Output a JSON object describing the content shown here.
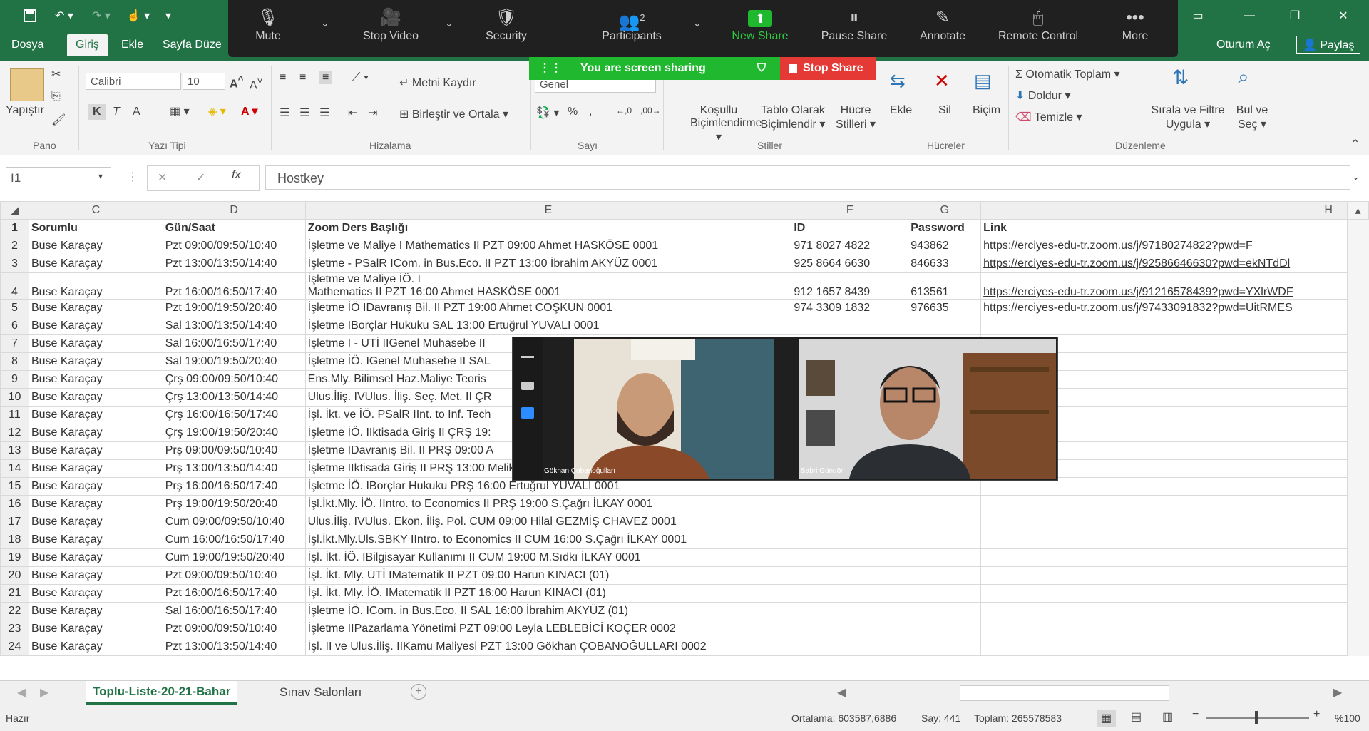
{
  "colors": {
    "excel_green": "#217346",
    "zoom_dark": "#202020",
    "share_green": "#1fb82e",
    "share_red": "#e53935",
    "link_blue": "#1a5fd6"
  },
  "excel": {
    "tabs": [
      "Dosya",
      "Giriş",
      "Ekle",
      "Sayfa Düze"
    ],
    "active_tab": "Giriş",
    "account": "Oturum Aç",
    "share": "Paylaş",
    "ribbon": {
      "paste": "Yapıştır",
      "font_name": "Calibri",
      "font_size": "10",
      "bold": "K",
      "italic": "T",
      "underline": "A",
      "wrap_text": "Metni Kaydır",
      "merge_center": "Birleştir ve Ortala",
      "number_format": "Genel",
      "conditional_1": "Koşullu",
      "conditional_2": "Biçimlendirme",
      "table_1": "Tablo Olarak",
      "table_2": "Biçimlendir",
      "cell_1": "Hücre",
      "cell_2": "Stilleri",
      "insert": "Ekle",
      "delete": "Sil",
      "format": "Biçim",
      "autosum": "Otomatik Toplam",
      "fill": "Doldur",
      "clear": "Temizle",
      "sort_1": "Sırala ve Filtre",
      "sort_2": "Uygula",
      "find_1": "Bul ve",
      "find_2": "Seç",
      "groups": [
        "Pano",
        "Yazı Tipi",
        "Hizalama",
        "Sayı",
        "Stiller",
        "Hücreler",
        "Düzenleme"
      ]
    },
    "formula_bar": {
      "name_box": "I1",
      "value": "Hostkey"
    },
    "columns": [
      "C",
      "D",
      "E",
      "F",
      "G",
      "H"
    ],
    "header_row": {
      "num": "1",
      "c": "Sorumlu",
      "d": "Gün/Saat",
      "e": "Zoom Ders Başlığı",
      "f": "ID",
      "g": "Password",
      "h": "Link"
    },
    "rows": [
      {
        "num": "2",
        "c": "Buse Karaçay",
        "d": "Pzt 09:00/09:50/10:40",
        "e": "İşletme ve Maliye I Mathematics II PZT 09:00 Ahmet HASKÖSE 0001",
        "f": "971 8027 4822",
        "g": "943862",
        "h": "https://erciyes-edu-tr.zoom.us/j/97180274822?pwd=F"
      },
      {
        "num": "3",
        "c": "Buse Karaçay",
        "d": "Pzt 13:00/13:50/14:40",
        "e": "İşletme - PSalR ICom. in Bus.Eco. II PZT 13:00 İbrahim AKYÜZ 0001",
        "f": "925 8664 6630",
        "g": "846633",
        "h": "https://erciyes-edu-tr.zoom.us/j/92586646630?pwd=ekNTdDl"
      },
      {
        "num": "5",
        "c": "Buse Karaçay",
        "d": "Pzt 19:00/19:50/20:40",
        "e": "İşletme İÖ IDavranış Bil. II PZT 19:00 Ahmet COŞKUN 0001",
        "f": "974 3309 1832",
        "g": "976635",
        "h": "https://erciyes-edu-tr.zoom.us/j/97433091832?pwd=UitRMES"
      },
      {
        "num": "6",
        "c": "Buse Karaçay",
        "d": "Sal 13:00/13:50/14:40",
        "e": "İşletme IBorçlar Hukuku SAL 13:00 Ertuğrul YUVALI 0001",
        "f": "",
        "g": "",
        "h": ""
      },
      {
        "num": "7",
        "c": "Buse Karaçay",
        "d": "Sal 16:00/16:50/17:40",
        "e": "İşletme I - UTİ IIGenel Muhasebe II",
        "f": "",
        "g": "",
        "h": ""
      },
      {
        "num": "8",
        "c": "Buse Karaçay",
        "d": "Sal 19:00/19:50/20:40",
        "e": "İşletme İÖ. IGenel Muhasebe II SAL",
        "f": "",
        "g": "",
        "h": ""
      },
      {
        "num": "9",
        "c": "Buse Karaçay",
        "d": "Çrş 09:00/09:50/10:40",
        "e": "Ens.Mly. Bilimsel Haz.Maliye Teoris",
        "f": "",
        "g": "",
        "h": ""
      },
      {
        "num": "10",
        "c": "Buse Karaçay",
        "d": "Çrş 13:00/13:50/14:40",
        "e": "Ulus.İliş. IVUlus. İliş. Seç. Met. II ÇR",
        "f": "",
        "g": "",
        "h": ""
      },
      {
        "num": "11",
        "c": "Buse Karaçay",
        "d": "Çrş 16:00/16:50/17:40",
        "e": "İşl. İkt. ve İÖ. PSalR IInt. to Inf. Tech",
        "f": "",
        "g": "",
        "h": ""
      },
      {
        "num": "12",
        "c": "Buse Karaçay",
        "d": "Çrş 19:00/19:50/20:40",
        "e": "İşletme İÖ. IIktisada Giriş II ÇRŞ 19:",
        "f": "",
        "g": "",
        "h": ""
      },
      {
        "num": "13",
        "c": "Buse Karaçay",
        "d": "Prş 09:00/09:50/10:40",
        "e": "İşletme IDavranış Bil. II PRŞ 09:00 A",
        "f": "",
        "g": "",
        "h": ""
      },
      {
        "num": "14",
        "c": "Buse Karaçay",
        "d": "Prş 13:00/13:50/14:40",
        "e": "İşletme IIktisada Giriş II PRŞ 13:00 Melike DEDEOĞLU 0001",
        "f": "",
        "g": "",
        "h": ""
      },
      {
        "num": "15",
        "c": "Buse Karaçay",
        "d": "Prş 16:00/16:50/17:40",
        "e": "İşletme İÖ. IBorçlar Hukuku PRŞ 16:00 Ertuğrul YUVALI 0001",
        "f": "",
        "g": "",
        "h": ""
      },
      {
        "num": "16",
        "c": "Buse Karaçay",
        "d": "Prş 19:00/19:50/20:40",
        "e": "İşl.İkt.Mly. İÖ. IIntro. to Economics II PRŞ 19:00 S.Çağrı İLKAY 0001",
        "f": "",
        "g": "",
        "h": ""
      },
      {
        "num": "17",
        "c": "Buse Karaçay",
        "d": "Cum 09:00/09:50/10:40",
        "e": "Ulus.İliş. IVUlus. Ekon. İliş. Pol. CUM 09:00 Hilal GEZMİŞ CHAVEZ 0001",
        "f": "",
        "g": "",
        "h": ""
      },
      {
        "num": "18",
        "c": "Buse Karaçay",
        "d": "Cum 16:00/16:50/17:40",
        "e": "İşl.İkt.Mly.Uls.SBKY IIntro. to Economics II CUM 16:00 S.Çağrı İLKAY 0001",
        "f": "",
        "g": "",
        "h": ""
      },
      {
        "num": "19",
        "c": "Buse Karaçay",
        "d": "Cum 19:00/19:50/20:40",
        "e": "İşl. İkt. İÖ. IBilgisayar Kullanımı II CUM 19:00 M.Sıdkı İLKAY 0001",
        "f": "",
        "g": "",
        "h": ""
      },
      {
        "num": "20",
        "c": "Buse Karaçay",
        "d": "Pzt 09:00/09:50/10:40",
        "e": "İşl. İkt. Mly. UTİ IMatematik II PZT 09:00 Harun KINACI (01)",
        "f": "",
        "g": "",
        "h": ""
      },
      {
        "num": "21",
        "c": "Buse Karaçay",
        "d": "Pzt 16:00/16:50/17:40",
        "e": "İşl. İkt. Mly. İÖ. IMatematik II PZT 16:00 Harun KINACI (01)",
        "f": "",
        "g": "",
        "h": ""
      },
      {
        "num": "22",
        "c": "Buse Karaçay",
        "d": "Sal 16:00/16:50/17:40",
        "e": "İşletme İÖ. ICom. in Bus.Eco. II SAL 16:00 İbrahim AKYÜZ (01)",
        "f": "",
        "g": "",
        "h": ""
      },
      {
        "num": "23",
        "c": "Buse Karaçay",
        "d": "Pzt 09:00/09:50/10:40",
        "e": "İşletme IIPazarlama Yönetimi PZT 09:00 Leyla LEBLEBİCİ KOÇER 0002",
        "f": "",
        "g": "",
        "h": ""
      },
      {
        "num": "24",
        "c": "Buse Karaçay",
        "d": "Pzt 13:00/13:50/14:40",
        "e": "İşl. II ve Ulus.İliş. IIKamu Maliyesi PZT 13:00 Gökhan ÇOBANOĞULLARI 0002",
        "f": "",
        "g": "",
        "h": ""
      }
    ],
    "row4": {
      "num": "4",
      "c": "Buse Karaçay",
      "d": "Pzt 16:00/16:50/17:40",
      "e1": "İşletme ve Maliye İÖ. I",
      "e2": "Mathematics II PZT 16:00 Ahmet HASKÖSE 0001",
      "f": "912 1657 8439",
      "g": "613561",
      "h": "https://erciyes-edu-tr.zoom.us/j/91216578439?pwd=YXlrWDF"
    },
    "sheet_tabs": [
      "Toplu-Liste-20-21-Bahar",
      "Sınav Salonları"
    ],
    "status": {
      "mode": "Hazır",
      "average": "Ortalama: 603587,6886",
      "count": "Say: 441",
      "sum": "Toplam: 265578583",
      "zoom": "%100"
    }
  },
  "zoom": {
    "buttons": {
      "mute": "Mute",
      "stop_video": "Stop Video",
      "security": "Security",
      "participants": "Participants",
      "participants_count": "2",
      "new_share": "New Share",
      "pause_share": "Pause Share",
      "annotate": "Annotate",
      "remote_control": "Remote Control",
      "more": "More"
    },
    "sharing_banner": "You are screen sharing",
    "stop_share": "Stop Share",
    "participant_1": "Gökhan Çobanoğulları",
    "participant_2": "Sabri Güngör"
  }
}
